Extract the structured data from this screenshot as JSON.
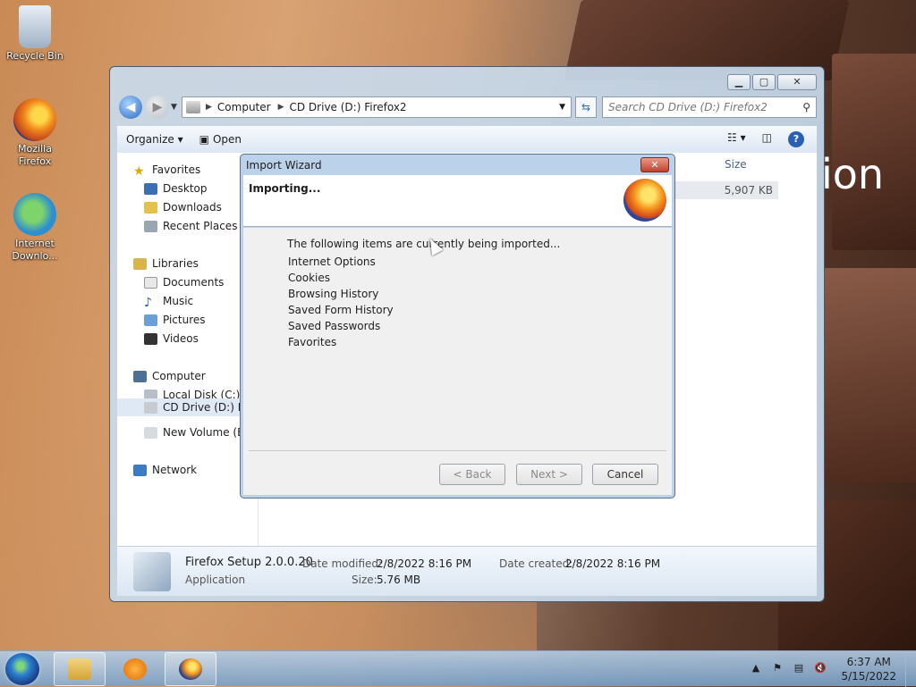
{
  "desktop": {
    "icons": [
      {
        "label": "Recycle Bin",
        "icon": "recycle-bin-icon"
      },
      {
        "label": "Mozilla Firefox",
        "icon": "firefox-icon"
      },
      {
        "label": "Internet Downlo...",
        "icon": "internet-download-manager-icon"
      }
    ],
    "wallpaper_text": "ion"
  },
  "explorer": {
    "address": {
      "crumbs": [
        "Computer",
        "CD Drive (D:) Firefox2"
      ]
    },
    "search_placeholder": "Search CD Drive (D:) Firefox2",
    "toolbar": {
      "organize": "Organize ▾",
      "open": "Open"
    },
    "nav": {
      "favorites": "Favorites",
      "favorites_items": [
        "Desktop",
        "Downloads",
        "Recent Places"
      ],
      "libraries": "Libraries",
      "libraries_items": [
        "Documents",
        "Music",
        "Pictures",
        "Videos"
      ],
      "computer": "Computer",
      "computer_items": [
        "Local Disk (C:)",
        "CD Drive (D:) Fire",
        "New Volume (E:)"
      ],
      "network": "Network"
    },
    "content": {
      "size_header": "Size",
      "size_value": "5,907 KB"
    },
    "details": {
      "name": "Firefox Setup 2.0.0.20",
      "type": "Application",
      "modified_label": "Date modified:",
      "modified_value": "2/8/2022 8:16 PM",
      "created_label": "Date created:",
      "created_value": "2/8/2022 8:16 PM",
      "size_label": "Size:",
      "size_value": "5.76 MB"
    }
  },
  "wizard": {
    "title": "Import Wizard",
    "close_glyph": "✕",
    "heading": "Importing...",
    "intro": "The following items are currently being imported...",
    "items": [
      "Internet Options",
      "Cookies",
      "Browsing History",
      "Saved Form History",
      "Saved Passwords",
      "Favorites"
    ],
    "buttons": {
      "back": "< Back",
      "next": "Next >",
      "cancel": "Cancel"
    }
  },
  "taskbar": {
    "time": "6:37 AM",
    "date": "5/15/2022"
  }
}
